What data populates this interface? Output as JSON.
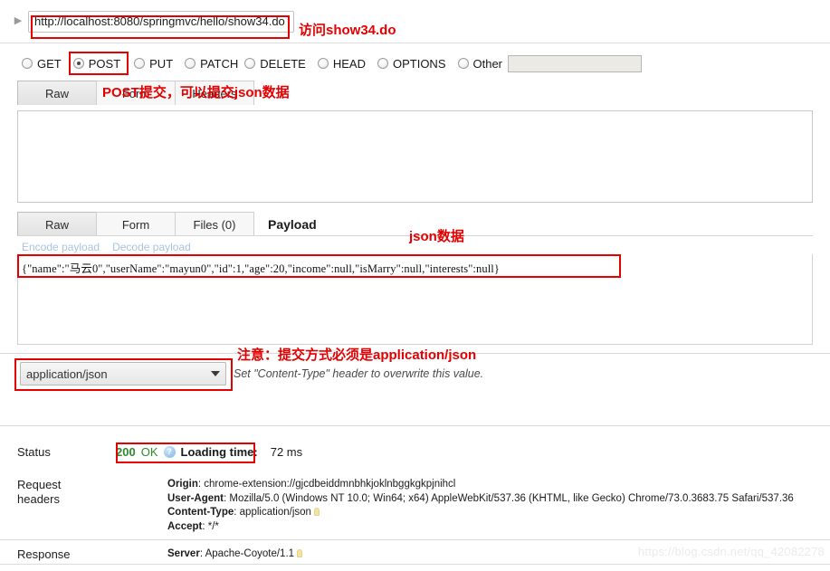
{
  "request": {
    "url_value": "http://localhost:8080/springmvc/hello/show34.do",
    "url_placeholder": "http://",
    "disclosure_icon": "triangle-right-icon",
    "methods": [
      {
        "label": "GET",
        "selected": false
      },
      {
        "label": "POST",
        "selected": true
      },
      {
        "label": "PUT",
        "selected": false
      },
      {
        "label": "PATCH",
        "selected": false
      },
      {
        "label": "DELETE",
        "selected": false
      },
      {
        "label": "HEAD",
        "selected": false
      },
      {
        "label": "OPTIONS",
        "selected": false
      },
      {
        "label": "Other",
        "selected": false
      }
    ],
    "other_method_value": "",
    "top_tabs": [
      {
        "label": "Raw",
        "active": true
      },
      {
        "label": "Form",
        "active": false
      },
      {
        "label": "Headers",
        "active": false
      }
    ],
    "raw_body_value": ""
  },
  "payload": {
    "tabs": [
      {
        "label": "Raw",
        "active": true
      },
      {
        "label": "Form",
        "active": false
      },
      {
        "label": "Files (0)",
        "active": false
      }
    ],
    "section_title": "Payload",
    "encode_link": "Encode payload",
    "decode_link": "Decode payload",
    "json_text": "{\"name\":\"马云0\",\"userName\":\"mayun0\",\"id\":1,\"age\":20,\"income\":null,\"isMarry\":null,\"interests\":null}"
  },
  "content_type": {
    "selected": "application/json",
    "caret_icon": "chevron-down-icon",
    "hint": "Set \"Content-Type\" header to overwrite this value."
  },
  "result": {
    "status_label": "Status",
    "status_code": "200",
    "status_text": "OK",
    "status_help_icon": "help-icon",
    "loading_time_label": "Loading time:",
    "loading_time_value": "72 ms",
    "request_headers_label_line1": "Request",
    "request_headers_label_line2": "headers",
    "request_headers": [
      {
        "key": "Origin",
        "value": "chrome-extension://gjcdbeiddmnbhkjoklnbggkgkpjnihcl",
        "bulb": false
      },
      {
        "key": "User-Agent",
        "value": "Mozilla/5.0 (Windows NT 10.0; Win64; x64) AppleWebKit/537.36 (KHTML, like Gecko) Chrome/73.0.3683.75 Safari/537.36",
        "bulb": false
      },
      {
        "key": "Content-Type",
        "value": "application/json",
        "bulb": true
      },
      {
        "key": "Accept",
        "value": "*/*",
        "bulb": false
      }
    ],
    "response_label": "Response",
    "response_header_key": "Server",
    "response_header_value": "Apache-Coyote/1.1"
  },
  "annotations": {
    "color": "#e40000",
    "url_note": "访问show34.do",
    "post_note": "POST提交，可以提交json数据",
    "json_note": "json数据",
    "content_type_note": "注意：提交方式必须是application/json"
  },
  "watermark": "https://blog.csdn.net/qq_42082278"
}
